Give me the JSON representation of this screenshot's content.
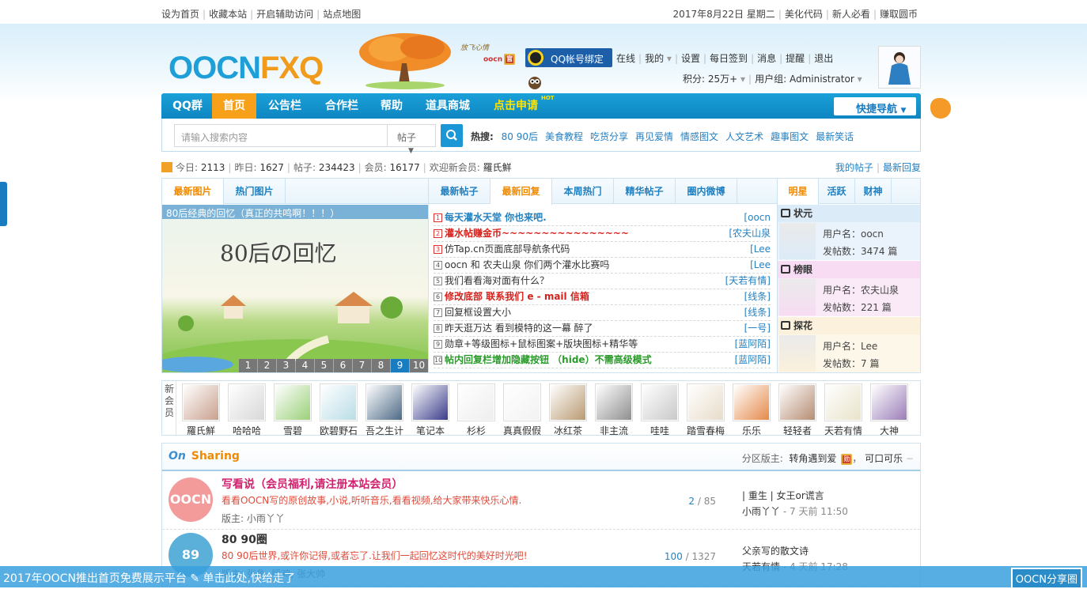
{
  "topbar": {
    "left": [
      "设为首页",
      "收藏本站",
      "开启辅助访问",
      "站点地图"
    ],
    "right": [
      "2017年8月22日 星期二",
      "美化代码",
      "新人必看",
      "赚取圆币"
    ]
  },
  "logo": {
    "part1": "OOCN",
    "part2": "FXQ"
  },
  "brand_small": "oocn",
  "brand_script": "放飞心情",
  "qq_bind": "QQ帐号绑定",
  "user_menu": {
    "row1": [
      "在线",
      "我的",
      "设置",
      "每日签到",
      "消息",
      "提醒",
      "退出"
    ],
    "points": "积分: 25万+",
    "group": "用户组: Administrator"
  },
  "nav": {
    "items": [
      "QQ群",
      "首页",
      "公告栏",
      "合作栏",
      "帮助",
      "道具商城",
      "点击申请"
    ],
    "badge": "HOT",
    "quick": "快捷导航"
  },
  "search": {
    "placeholder": "请输入搜索内容",
    "type": "帖子",
    "hot_label": "热搜:",
    "hot_words": [
      "80 90后",
      "美食教程",
      "吃货分享",
      "再见爱情",
      "情感图文",
      "人文艺术",
      "趣事图文",
      "最新笑话"
    ]
  },
  "stats": {
    "today_l": "今日:",
    "today": "2113",
    "yest_l": "昨日:",
    "yesterday": "1627",
    "posts_l": "帖子:",
    "posts": "234423",
    "members_l": "会员:",
    "members": "16177",
    "newest_l": "欢迎新会员:",
    "newest": "羅氏鮮",
    "my_posts": "我的帖子",
    "latest_reply": "最新回复"
  },
  "photo_tabs": [
    "最新图片",
    "热门图片"
  ],
  "slider": {
    "caption": "80后经典的回忆（真正的共鸣啊！！！）",
    "big_text": "80后の回忆",
    "pages": [
      "1",
      "2",
      "3",
      "4",
      "5",
      "6",
      "7",
      "8",
      "9",
      "10"
    ],
    "active": "9"
  },
  "post_tabs": [
    "最新帖子",
    "最新回复",
    "本周热门",
    "精华帖子",
    "圈内微博"
  ],
  "posts": [
    {
      "n": "1",
      "title": "每天灌水天堂 你也来吧.",
      "author": "[oocn",
      "style": "t-blue"
    },
    {
      "n": "2",
      "title": "灌水帖赚金币~~~~~~~~~~~~~~~~",
      "author": "[农夫山泉",
      "style": "t-red"
    },
    {
      "n": "3",
      "title": "仿Tap.cn页面底部导航条代码",
      "author": "[Lee",
      "style": ""
    },
    {
      "n": "4",
      "title": "oocn 和 农夫山泉 你们两个灌水比赛吗",
      "author": "[Lee",
      "style": ""
    },
    {
      "n": "5",
      "title": "我们看看海对面有什么？",
      "author": "[天若有情]",
      "style": ""
    },
    {
      "n": "6",
      "title": "修改底部 联系我们 e - mail 信箱",
      "author": "[线条]",
      "style": "t-red"
    },
    {
      "n": "7",
      "title": "回复框设置大小",
      "author": "[线条]",
      "style": ""
    },
    {
      "n": "8",
      "title": "昨天逛万达 看到模特的这一幕 醉了",
      "author": "[一号]",
      "style": ""
    },
    {
      "n": "9",
      "title": "勋章+等级图标+鼠标图案+版块图标+精华等",
      "author": "[蓝阿陌]",
      "style": ""
    },
    {
      "n": "10",
      "title": "帖内回复栏增加隐藏按钮 （hide）不需高级模式",
      "author": "[蓝阿陌]",
      "style": "t-green"
    }
  ],
  "star_tabs": [
    "明星",
    "活跃",
    "财神"
  ],
  "stars": [
    {
      "rank": "状元",
      "user": "用户名：oocn",
      "posts": "发帖数：3474 篇",
      "color": "#dcebf8"
    },
    {
      "rank": "榜眼",
      "user": "用户名：农夫山泉",
      "posts": "发帖数：221 篇",
      "color": "#f7dcf3"
    },
    {
      "rank": "探花",
      "user": "用户名：Lee",
      "posts": "发帖数：7 篇",
      "color": "#fbf1dc"
    }
  ],
  "members_label": "新会员",
  "new_members": [
    {
      "name": "羅氏鮮",
      "c": "#c9a08e"
    },
    {
      "name": "哈哈哈",
      "c": "#d8d8d8"
    },
    {
      "name": "雪碧",
      "c": "#9bd07a"
    },
    {
      "name": "欧碧野石",
      "c": "#b9dde6"
    },
    {
      "name": "吾之生计",
      "c": "#4d6a86"
    },
    {
      "name": "笔记本",
      "c": "#3a3c8a"
    },
    {
      "name": "杉杉",
      "c": "#eeeeee"
    },
    {
      "name": "真真假假",
      "c": "#f2f2f2"
    },
    {
      "name": "冰红茶",
      "c": "#b99a72"
    },
    {
      "name": "非主流",
      "c": "#8f8f8f"
    },
    {
      "name": "哇哇",
      "c": "#c9c9c9"
    },
    {
      "name": "踏雪春梅",
      "c": "#e8dccb"
    },
    {
      "name": "乐乐",
      "c": "#e58a4a"
    },
    {
      "name": "轻轻者",
      "c": "#b58d73"
    },
    {
      "name": "天若有情",
      "c": "#e8e3c9"
    },
    {
      "name": "大神",
      "c": "#9b7db8"
    }
  ],
  "sharing": {
    "title": "Sharing",
    "mod_label": "分区版主:",
    "mod1": "转角遇到爱",
    "mod2": "可口可乐",
    "forums": [
      {
        "icon": "OOCN",
        "color": "#f39b9b",
        "title": "写看说（会员福利,请注册本站会员）",
        "title_color": "#d0226e",
        "desc": "看看OOCN写的原创故事,小说,听听音乐,看看视频,给大家带来快乐心情.",
        "mods": "版主: 小雨丫丫",
        "threads": "2",
        "posts": "85",
        "last_title": "| 重生 | 女王or谎言",
        "last_user": "小雨丫丫",
        "last_time": "- 7 天前 11:50"
      },
      {
        "icon": "89",
        "color": "#5ab0d8",
        "title": "80 90圈",
        "title_color": "#333",
        "desc": "80 90后世界,或许你记得,或者忘了.让我们一起回忆这时代的美好时光吧!",
        "mods": "版主: 张鱼, 睡鸡, 张大帅",
        "threads": "100",
        "posts": "1327",
        "last_title": "父亲写的散文诗",
        "last_user": "天若有情",
        "last_time": "- 4 天前 17:28"
      }
    ]
  },
  "footer": {
    "text": "2017年OOCN推出首页免费展示平台 ✎ 单击此处,快给走了",
    "button": "OOCN分享圈"
  }
}
